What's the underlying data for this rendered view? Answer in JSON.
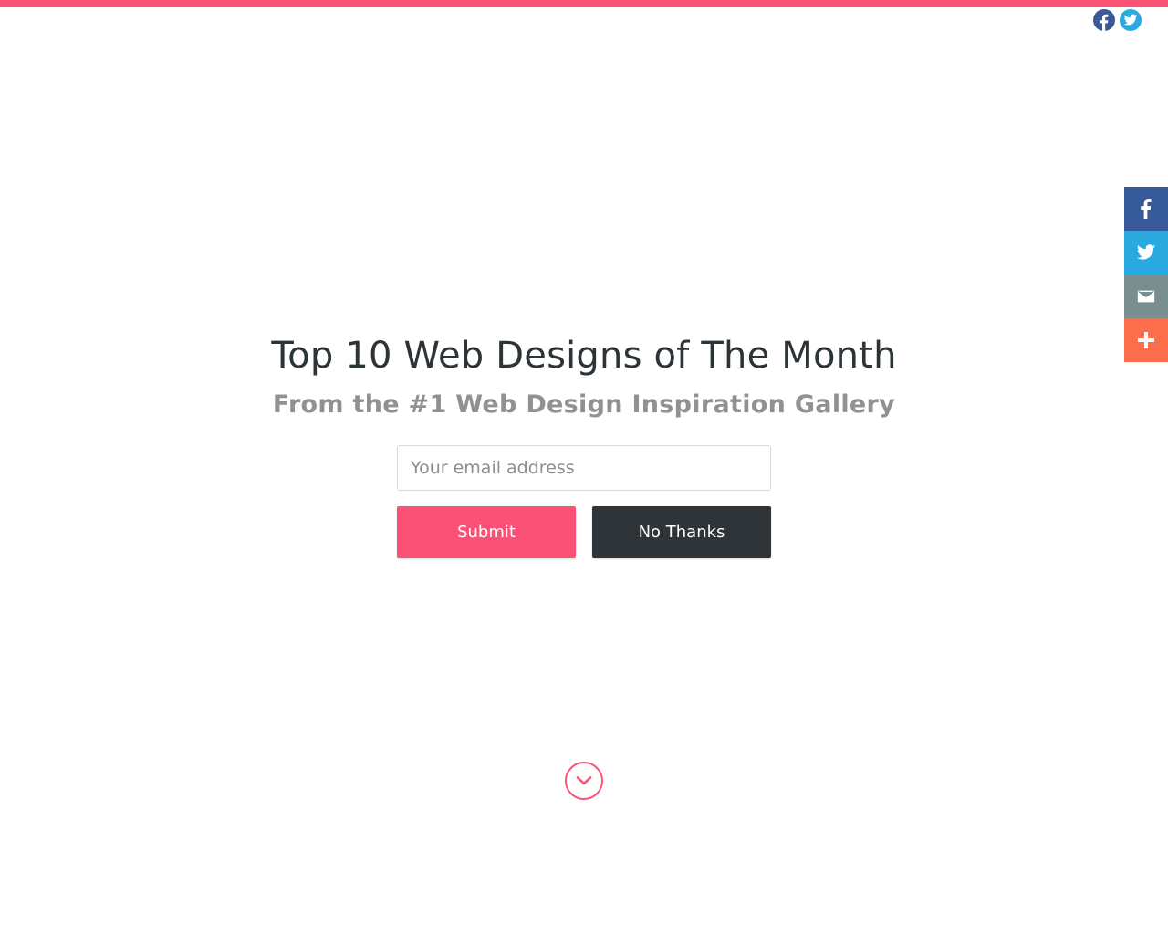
{
  "colors": {
    "accent": "#fb5476",
    "submit": "#fb5177",
    "dark": "#2e3437",
    "facebook": "#375a9a",
    "twitter": "#28aae1",
    "email": "#798e8e",
    "more": "#fc6d4c"
  },
  "header": {
    "social": [
      {
        "icon": "facebook-icon"
      },
      {
        "icon": "twitter-icon"
      }
    ]
  },
  "share_bar": {
    "items": [
      {
        "icon": "facebook-icon"
      },
      {
        "icon": "twitter-icon"
      },
      {
        "icon": "email-icon"
      },
      {
        "icon": "plus-icon"
      }
    ]
  },
  "hero": {
    "title": "Top 10 Web Designs of The Month",
    "subtitle": "From the #1 Web Design Inspiration Gallery"
  },
  "form": {
    "email_placeholder": "Your email address",
    "submit_label": "Submit",
    "no_thanks_label": "No Thanks"
  },
  "scroll": {
    "icon": "chevron-down-icon"
  }
}
